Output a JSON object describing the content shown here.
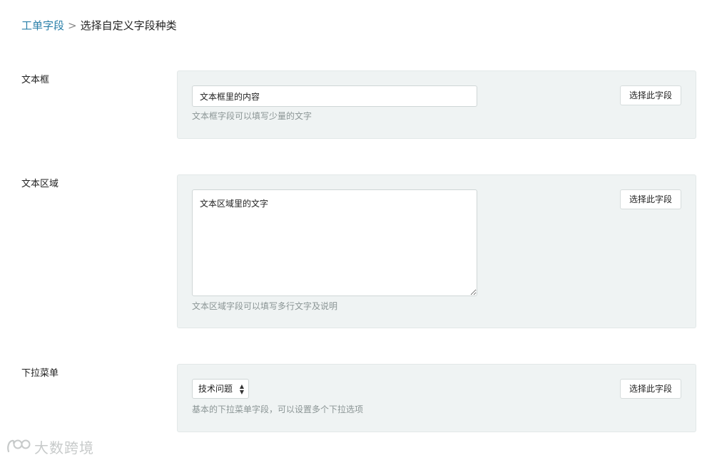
{
  "breadcrumb": {
    "parent": "工单字段",
    "separator": ">",
    "current": "选择自定义字段种类"
  },
  "fields": {
    "textbox": {
      "label": "文本框",
      "input_value": "文本框里的内容",
      "hint": "文本框字段可以填写少量的文字",
      "button": "选择此字段"
    },
    "textarea": {
      "label": "文本区域",
      "input_value": "文本区域里的文字",
      "hint": "文本区域字段可以填写多行文字及说明",
      "button": "选择此字段"
    },
    "dropdown": {
      "label": "下拉菜单",
      "selected_option": "技术问题",
      "hint": "基本的下拉菜单字段，可以设置多个下拉选项",
      "button": "选择此字段"
    }
  },
  "watermark": {
    "text": "大数跨境"
  },
  "colors": {
    "link": "#2a7fa8",
    "panel_bg": "#eff3f3",
    "hint_text": "#8b9595"
  }
}
